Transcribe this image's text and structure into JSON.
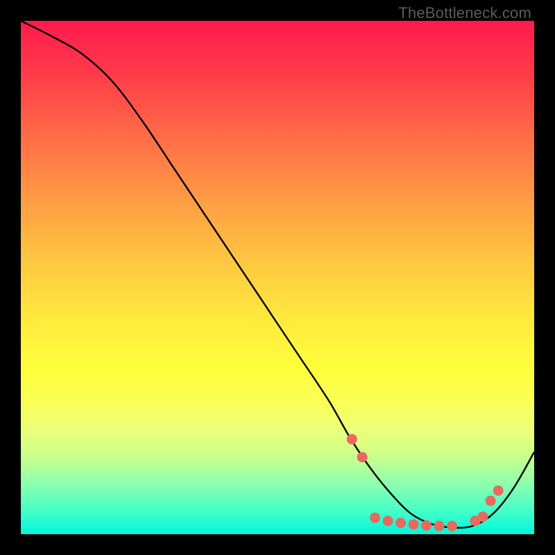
{
  "watermark": "TheBottleneck.com",
  "chart_data": {
    "type": "line",
    "title": "",
    "xlabel": "",
    "ylabel": "",
    "xlim": [
      0,
      100
    ],
    "ylim": [
      0,
      100
    ],
    "grid": false,
    "legend": false,
    "series": [
      {
        "name": "curve",
        "x": [
          0,
          6,
          12,
          18,
          24,
          30,
          36,
          42,
          48,
          54,
          60,
          64,
          68,
          72,
          76,
          80,
          84,
          88,
          92,
          96,
          100
        ],
        "y": [
          100,
          97,
          93.5,
          88,
          80,
          71,
          62,
          53,
          44,
          35,
          26,
          19,
          13,
          8,
          4,
          2,
          1.3,
          1.6,
          4,
          9,
          16
        ]
      }
    ],
    "markers": [
      {
        "x": 64.5,
        "y": 18.5
      },
      {
        "x": 66.5,
        "y": 15.0
      },
      {
        "x": 69.0,
        "y": 3.2
      },
      {
        "x": 71.5,
        "y": 2.6
      },
      {
        "x": 74.0,
        "y": 2.2
      },
      {
        "x": 76.5,
        "y": 1.9
      },
      {
        "x": 79.0,
        "y": 1.7
      },
      {
        "x": 81.5,
        "y": 1.6
      },
      {
        "x": 84.0,
        "y": 1.6
      },
      {
        "x": 88.5,
        "y": 2.6
      },
      {
        "x": 90.0,
        "y": 3.4
      },
      {
        "x": 91.5,
        "y": 6.5
      },
      {
        "x": 93.0,
        "y": 8.5
      }
    ]
  }
}
